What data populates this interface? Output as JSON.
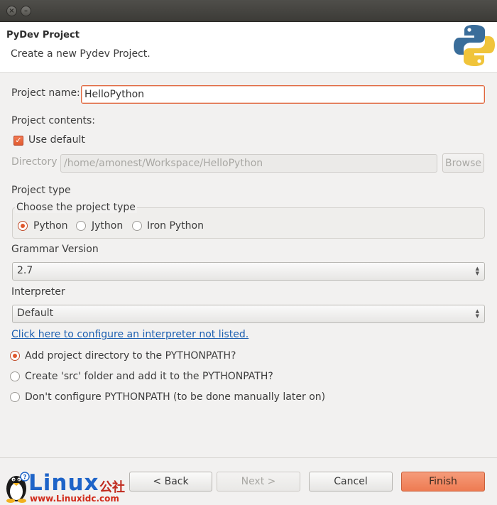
{
  "window": {
    "close_glyph": "×",
    "minimize_glyph": "–"
  },
  "header": {
    "title": "PyDev  Project",
    "description": "Create a new Pydev Project.",
    "logo_icon": "python-logo-icon"
  },
  "project_name": {
    "label": "Project name:",
    "value": "HelloPython"
  },
  "project_contents": {
    "label": "Project contents:",
    "use_default_label": "Use default",
    "use_default_checked": true,
    "directory_label": "Directory",
    "directory_value": "/home/amonest/Workspace/HelloPython",
    "browse_label": "Browse"
  },
  "project_type": {
    "label": "Project type",
    "group_title": "Choose the project type",
    "options": [
      "Python",
      "Jython",
      "Iron Python"
    ],
    "selected": "Python"
  },
  "grammar": {
    "label": "Grammar Version",
    "value": "2.7"
  },
  "interpreter": {
    "label": "Interpreter",
    "value": "Default",
    "configure_link": "Click here to configure an interpreter not listed."
  },
  "pythonpath": {
    "options": [
      "Add project directory to the PYTHONPATH?",
      "Create 'src' folder and add it to the PYTHONPATH?",
      "Don't configure PYTHONPATH (to be done manually later on)"
    ],
    "selected_index": 0
  },
  "buttons": {
    "back": "< Back",
    "next": "Next >",
    "cancel": "Cancel",
    "finish": "Finish"
  },
  "watermark": {
    "brand": "Linux",
    "brand_cn": "公社",
    "url": "www.Linuxidc.com"
  },
  "colors": {
    "accent": "#e0582d",
    "link": "#1c5fb0",
    "finish_button": "#ee7b52"
  }
}
